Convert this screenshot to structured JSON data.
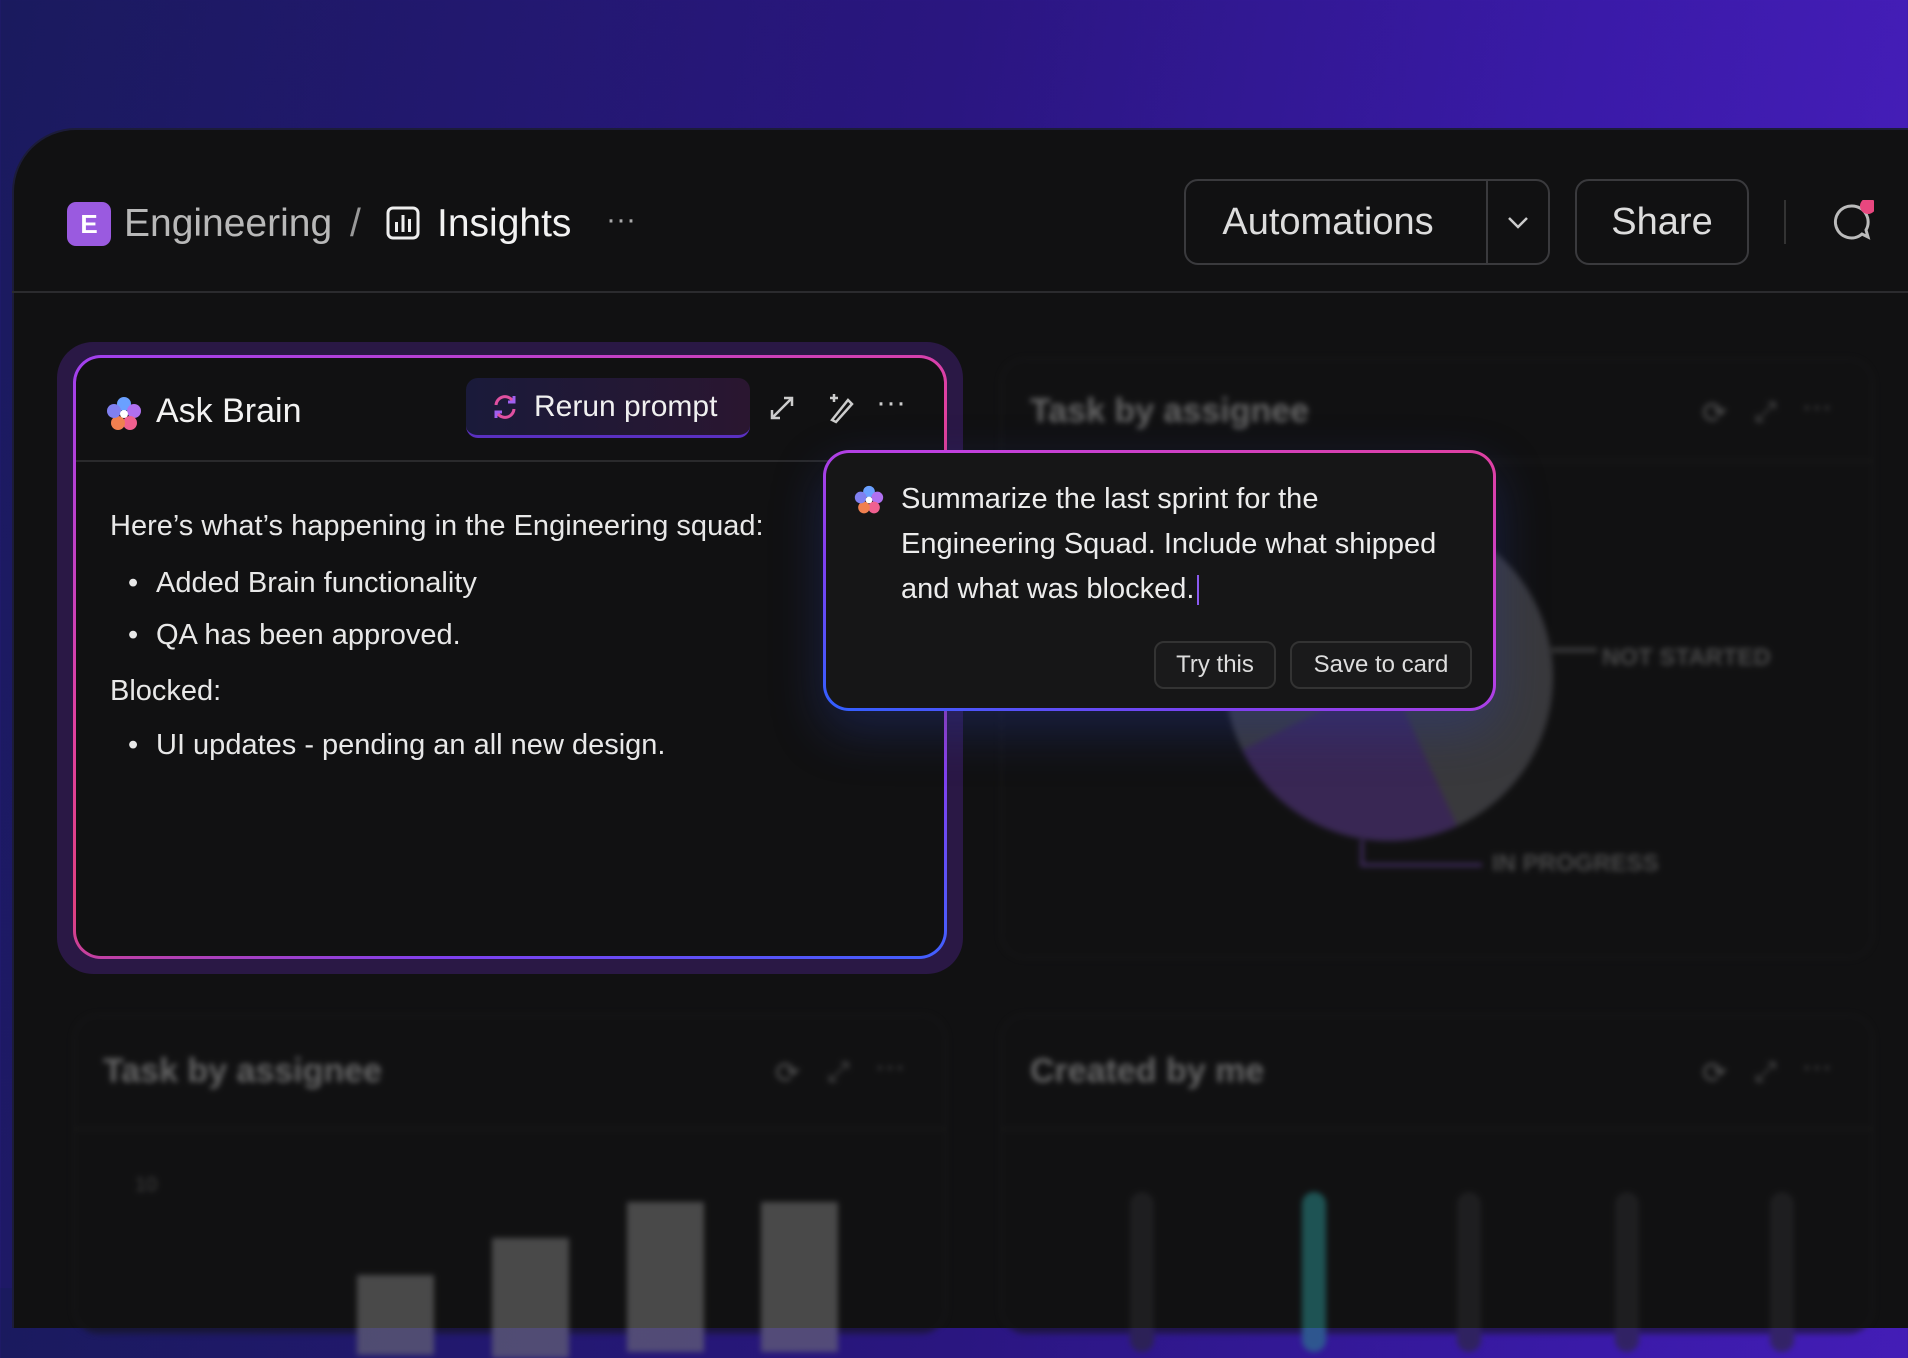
{
  "header": {
    "workspace_initial": "E",
    "workspace": "Engineering",
    "separator": "/",
    "page": "Insights",
    "more": "···",
    "automations_label": "Automations",
    "share_label": "Share"
  },
  "ask_brain": {
    "title": "Ask Brain",
    "rerun_label": "Rerun prompt",
    "more": "···",
    "intro": "Here’s what’s happening in the Engineering squad:",
    "shipped": [
      "Added Brain functionality",
      "QA has been approved."
    ],
    "blocked_label": "Blocked:",
    "blocked": [
      "UI updates - pending an all new design."
    ]
  },
  "prompt_popup": {
    "text": "Summarize the last sprint for the Engineering Squad. Include what shipped and what was blocked.",
    "try_label": "Try this",
    "save_label": "Save to card"
  },
  "cards": [
    {
      "title": "Task by assignee",
      "more": "···",
      "legend": [
        "NOT STARTED",
        "IN PROGRESS"
      ]
    },
    {
      "title": "Task by assignee",
      "more": "···",
      "y_tick": "10"
    },
    {
      "title": "Created by me",
      "more": "···"
    }
  ],
  "colors": {
    "accent_purple": "#9a5ae0",
    "notification": "#e8477f",
    "teal": "#2a8a8a"
  }
}
